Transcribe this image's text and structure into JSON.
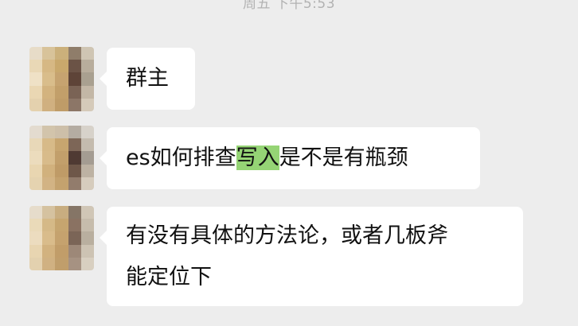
{
  "chat": {
    "timestamp": "周五 下午5:53",
    "messages": [
      {
        "avatar_colors": [
          "#e7dcc8",
          "#d8c39a",
          "#cbb07b",
          "#8f7d6a",
          "#cfc5b3",
          "#e9d8b6",
          "#d6b884",
          "#c9a86c",
          "#6b5346",
          "#b8ad9c",
          "#efe1c6",
          "#d9bd8b",
          "#c6a370",
          "#5e4438",
          "#a9a090",
          "#ead7b3",
          "#d3b37f",
          "#c29f6a",
          "#7a6355",
          "#c3b7a6",
          "#e4d1ae",
          "#d0b080",
          "#bf9c68",
          "#8c7667",
          "#d5cab9"
        ],
        "text": "群主"
      },
      {
        "avatar_colors": [
          "#e3dbcf",
          "#d2c4ab",
          "#cdbfa9",
          "#b4aca2",
          "#d7d2ca",
          "#e8d8b8",
          "#d7ba88",
          "#c7a56f",
          "#7d6657",
          "#c4bbae",
          "#ecdcbd",
          "#d8bb8a",
          "#c29f6b",
          "#4f3a33",
          "#a49c92",
          "#e9d6b1",
          "#d1b17d",
          "#bf9b67",
          "#6e5749",
          "#bdb2a3",
          "#e5d3b0",
          "#d2b384",
          "#c4a26e",
          "#927c6c",
          "#d6ccbd"
        ],
        "text_before": "es如何排查",
        "text_highlight": "写入",
        "text_after": "是不是有瓶颈"
      },
      {
        "avatar_colors": [
          "#e6dccb",
          "#d5c2a0",
          "#c8ad80",
          "#857566",
          "#d0c6b6",
          "#eadab9",
          "#d5b987",
          "#c6a56f",
          "#8a7262",
          "#c6bcac",
          "#ecdcbf",
          "#d9bc8b",
          "#c5a26e",
          "#7b6557",
          "#b9af9f",
          "#e8d5b1",
          "#d2b27f",
          "#c19d69",
          "#9d8878",
          "#cdc3b3",
          "#e3d1af",
          "#d0b182",
          "#c09e6b",
          "#a69282",
          "#d8cfc0"
        ],
        "lines": [
          "有没有具体的方法论，或者几板斧",
          "能定位下"
        ]
      }
    ]
  }
}
